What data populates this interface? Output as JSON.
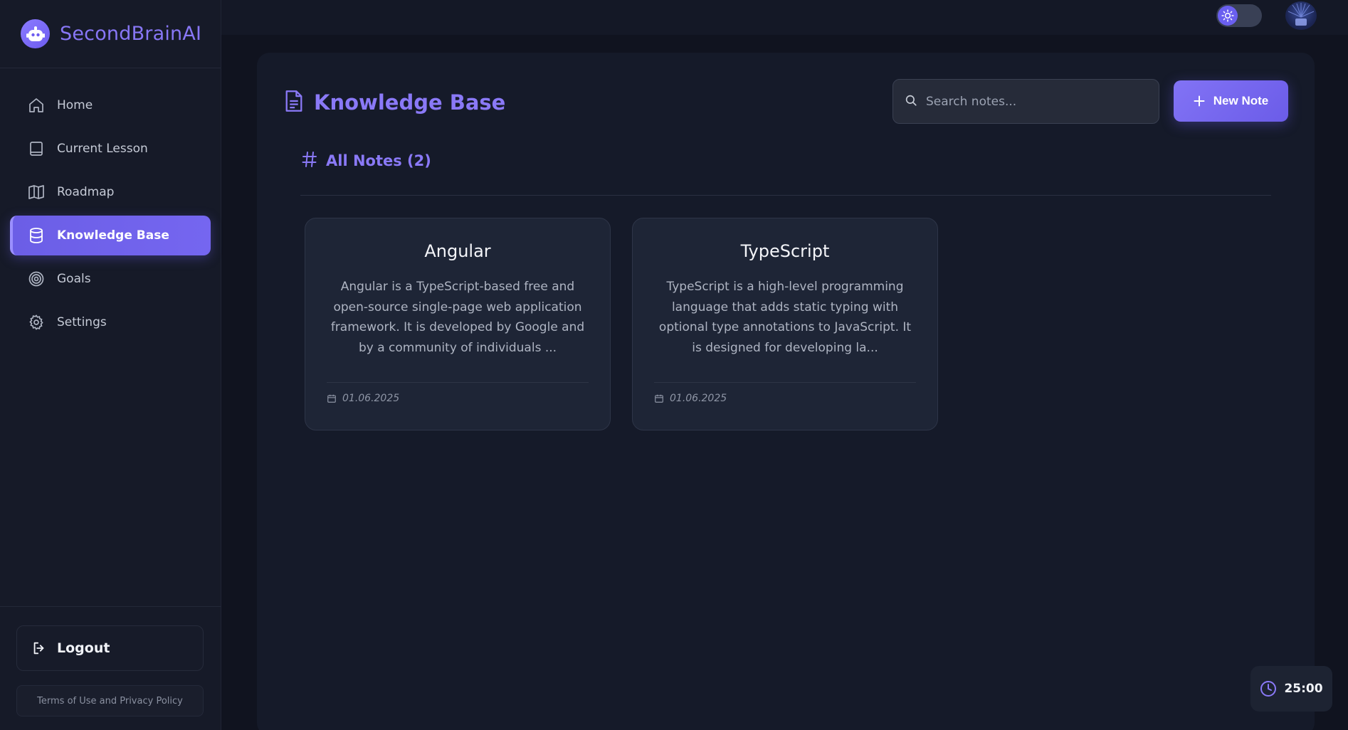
{
  "brand": {
    "name": "SecondBrainAI",
    "icon": "robot-icon"
  },
  "sidebar": {
    "items": [
      {
        "label": "Home",
        "icon": "home-icon"
      },
      {
        "label": "Current Lesson",
        "icon": "book-icon"
      },
      {
        "label": "Roadmap",
        "icon": "map-icon"
      },
      {
        "label": "Knowledge Base",
        "icon": "database-icon",
        "active": true
      },
      {
        "label": "Goals",
        "icon": "target-icon"
      },
      {
        "label": "Settings",
        "icon": "gear-icon"
      }
    ],
    "logout_label": "Logout",
    "terms_label": "Terms of Use and Privacy Policy"
  },
  "header": {
    "theme_icon": "sun-icon",
    "avatar_icon": "avatar"
  },
  "main": {
    "title": "Knowledge Base",
    "search": {
      "placeholder": "Search notes...",
      "value": ""
    },
    "new_note_label": "New Note",
    "section_title": "All Notes (2)",
    "notes": [
      {
        "title": "Angular",
        "excerpt": "Angular is a TypeScript-based free and open-source single-page web application framework. It is developed by Google and by a community of individuals ...",
        "date": "01.06.2025"
      },
      {
        "title": "TypeScript",
        "excerpt": "TypeScript is a high-level programming language that adds static typing with optional type annotations to JavaScript. It is designed for developing la...",
        "date": "01.06.2025"
      }
    ]
  },
  "timer": {
    "value": "25:00",
    "icon": "clock-icon"
  },
  "colors": {
    "accent": "#7566f0",
    "accent_text": "#8a79f7",
    "background": "#10131f",
    "sidebar": "#161a28",
    "card": "#1e2536"
  }
}
